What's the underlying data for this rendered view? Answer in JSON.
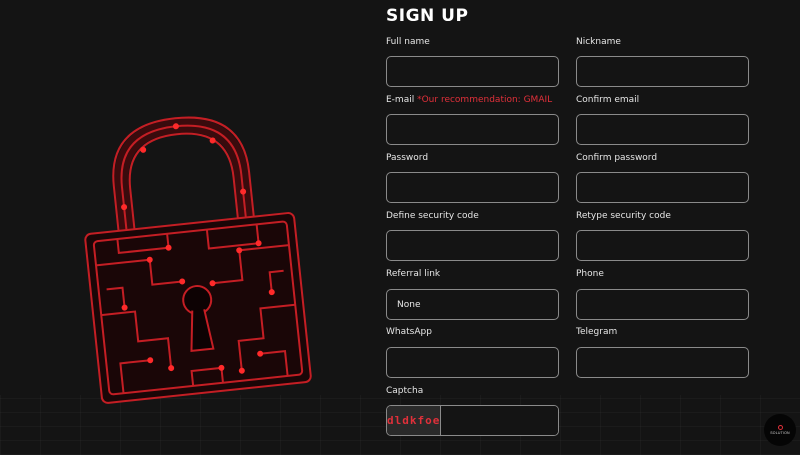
{
  "form": {
    "title": "SIGN UP",
    "full_name": {
      "label": "Full name",
      "value": ""
    },
    "nickname": {
      "label": "Nickname",
      "value": ""
    },
    "email": {
      "label": "E-mail",
      "hint": "*Our recommendation: GMAIL",
      "value": ""
    },
    "confirm_email": {
      "label": "Confirm email",
      "value": ""
    },
    "password": {
      "label": "Password",
      "value": ""
    },
    "confirm_password": {
      "label": "Confirm password",
      "value": ""
    },
    "security_code": {
      "label": "Define security code",
      "value": ""
    },
    "retype_security_code": {
      "label": "Retype security code",
      "value": ""
    },
    "referral": {
      "label": "Referral link",
      "placeholder": "None"
    },
    "phone": {
      "label": "Phone",
      "value": ""
    },
    "whatsapp": {
      "label": "WhatsApp",
      "value": ""
    },
    "telegram": {
      "label": "Telegram",
      "value": ""
    },
    "captcha": {
      "label": "Captcha",
      "code": "dldkfoe",
      "value": ""
    }
  },
  "badge": {
    "text": "SOLUTION"
  },
  "colors": {
    "background": "#141414",
    "accent": "#e0303a",
    "field_border": "#8a8a8a"
  },
  "icons": {
    "lock": "circuit-lock-icon"
  }
}
